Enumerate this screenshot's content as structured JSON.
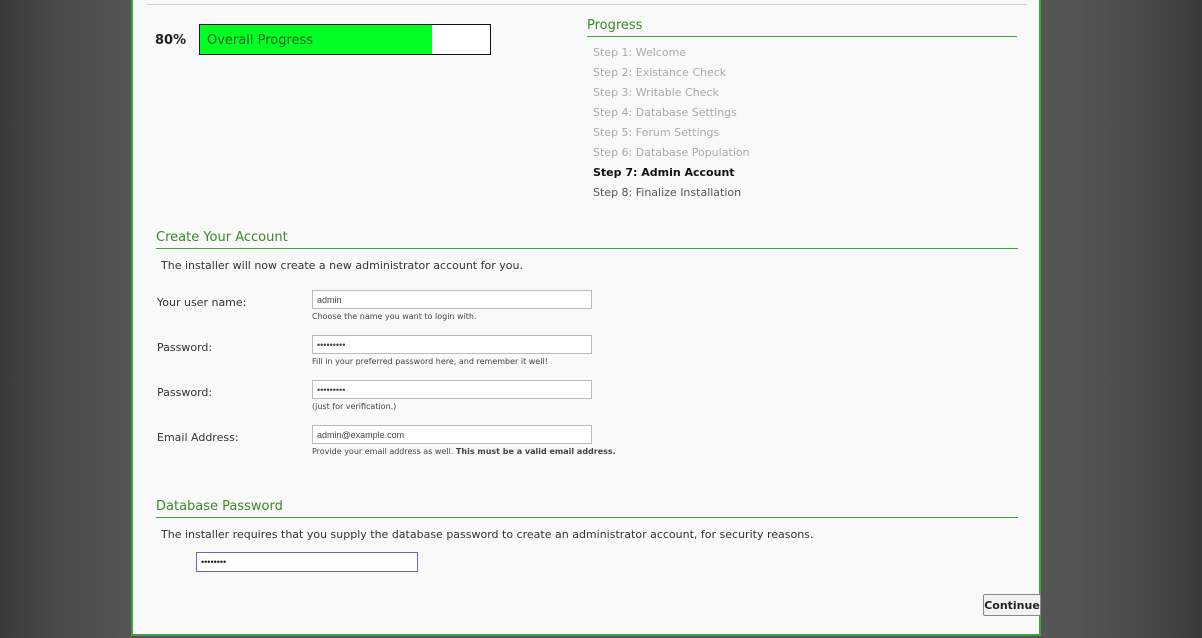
{
  "progress": {
    "percent_label": "80%",
    "fraction": 0.8,
    "bar_label": "Overall Progress",
    "fill_color": "#00ff24"
  },
  "steps_panel": {
    "title": "Progress",
    "steps": [
      {
        "label": "Step 1: Welcome",
        "state": "done"
      },
      {
        "label": "Step 2: Existance Check",
        "state": "done"
      },
      {
        "label": "Step 3: Writable Check",
        "state": "done"
      },
      {
        "label": "Step 4: Database Settings",
        "state": "done"
      },
      {
        "label": "Step 5: Forum Settings",
        "state": "done"
      },
      {
        "label": "Step 6: Database Population",
        "state": "done"
      },
      {
        "label": "Step 7: Admin Account",
        "state": "current"
      },
      {
        "label": "Step 8: Finalize Installation",
        "state": "pending"
      }
    ]
  },
  "account": {
    "title": "Create Your Account",
    "intro": "The installer will now create a new administrator account for you.",
    "fields": {
      "username": {
        "label": "Your user name:",
        "value": "admin",
        "hint": "Choose the name you want to login with."
      },
      "password": {
        "label": "Password:",
        "value": "•••••••••",
        "hint": "Fill in your preferred password here, and remember it well!"
      },
      "password_confirm": {
        "label": "Password:",
        "value": "•••••••••",
        "hint": "(just for verification.)"
      },
      "email": {
        "label": "Email Address:",
        "value": "admin@example.com",
        "hint": "Provide your email address as well.",
        "hint_bold": "This must be a valid email address."
      }
    }
  },
  "database": {
    "title": "Database Password",
    "intro": "The installer requires that you supply the database password to create an administrator account, for security reasons.",
    "password_value": "••••••••"
  },
  "continue_label": "Continue",
  "colors": {
    "accent_green": "#3aa53a",
    "focus_border": "#6c63c7"
  }
}
